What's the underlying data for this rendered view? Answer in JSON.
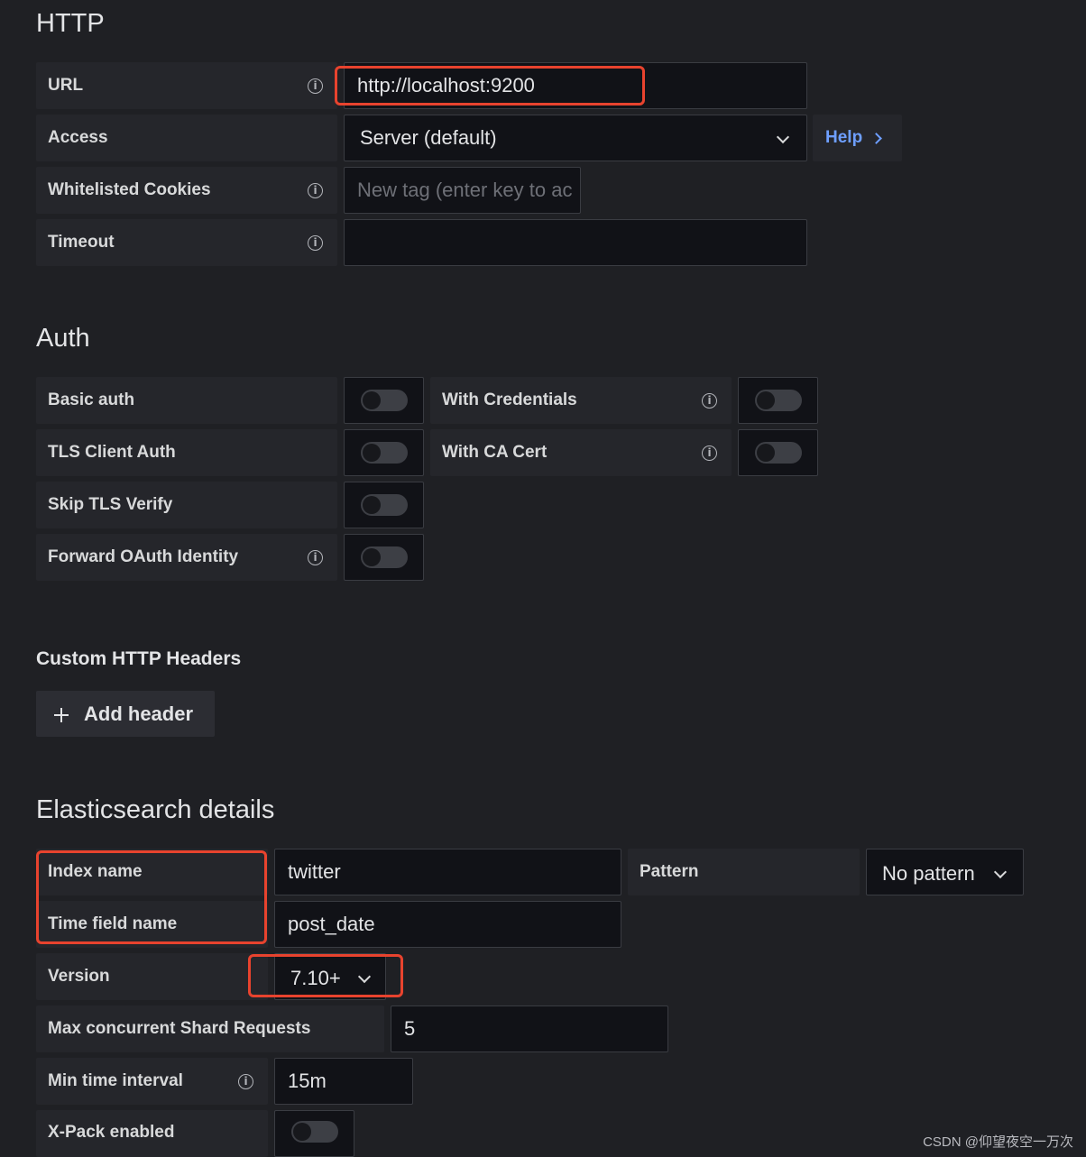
{
  "http": {
    "title": "HTTP",
    "url": {
      "label": "URL",
      "value": "http://localhost:9200"
    },
    "access": {
      "label": "Access",
      "value": "Server (default)",
      "help": "Help"
    },
    "cookies": {
      "label": "Whitelisted Cookies",
      "placeholder": "New tag (enter key to ac"
    },
    "timeout": {
      "label": "Timeout",
      "value": ""
    }
  },
  "auth": {
    "title": "Auth",
    "basic_auth": "Basic auth",
    "with_credentials": "With Credentials",
    "tls_client_auth": "TLS Client Auth",
    "with_ca_cert": "With CA Cert",
    "skip_tls_verify": "Skip TLS Verify",
    "forward_oauth": "Forward OAuth Identity",
    "toggles": {
      "basic_auth": false,
      "with_credentials": false,
      "tls_client_auth": false,
      "with_ca_cert": false,
      "skip_tls_verify": false,
      "forward_oauth": false
    }
  },
  "headers": {
    "title": "Custom HTTP Headers",
    "add_label": "Add header",
    "add_icon": "plus-icon"
  },
  "es": {
    "title": "Elasticsearch details",
    "index_name": {
      "label": "Index name",
      "value": "twitter"
    },
    "pattern": {
      "label": "Pattern",
      "value": "No pattern"
    },
    "time_field": {
      "label": "Time field name",
      "value": "post_date"
    },
    "version": {
      "label": "Version",
      "value": "7.10+"
    },
    "max_shard": {
      "label": "Max concurrent Shard Requests",
      "value": "5"
    },
    "min_interval": {
      "label": "Min time interval",
      "value": "15m"
    },
    "xpack": {
      "label": "X-Pack enabled",
      "enabled": false
    }
  },
  "icons": {
    "info": "i",
    "help_arrow": "chevron-right-icon",
    "dropdown": "chevron-down-icon"
  },
  "colors": {
    "background": "#1f2024",
    "highlight": "#e8432e",
    "link": "#6e9fff"
  },
  "watermark": "CSDN @仰望夜空一万次"
}
